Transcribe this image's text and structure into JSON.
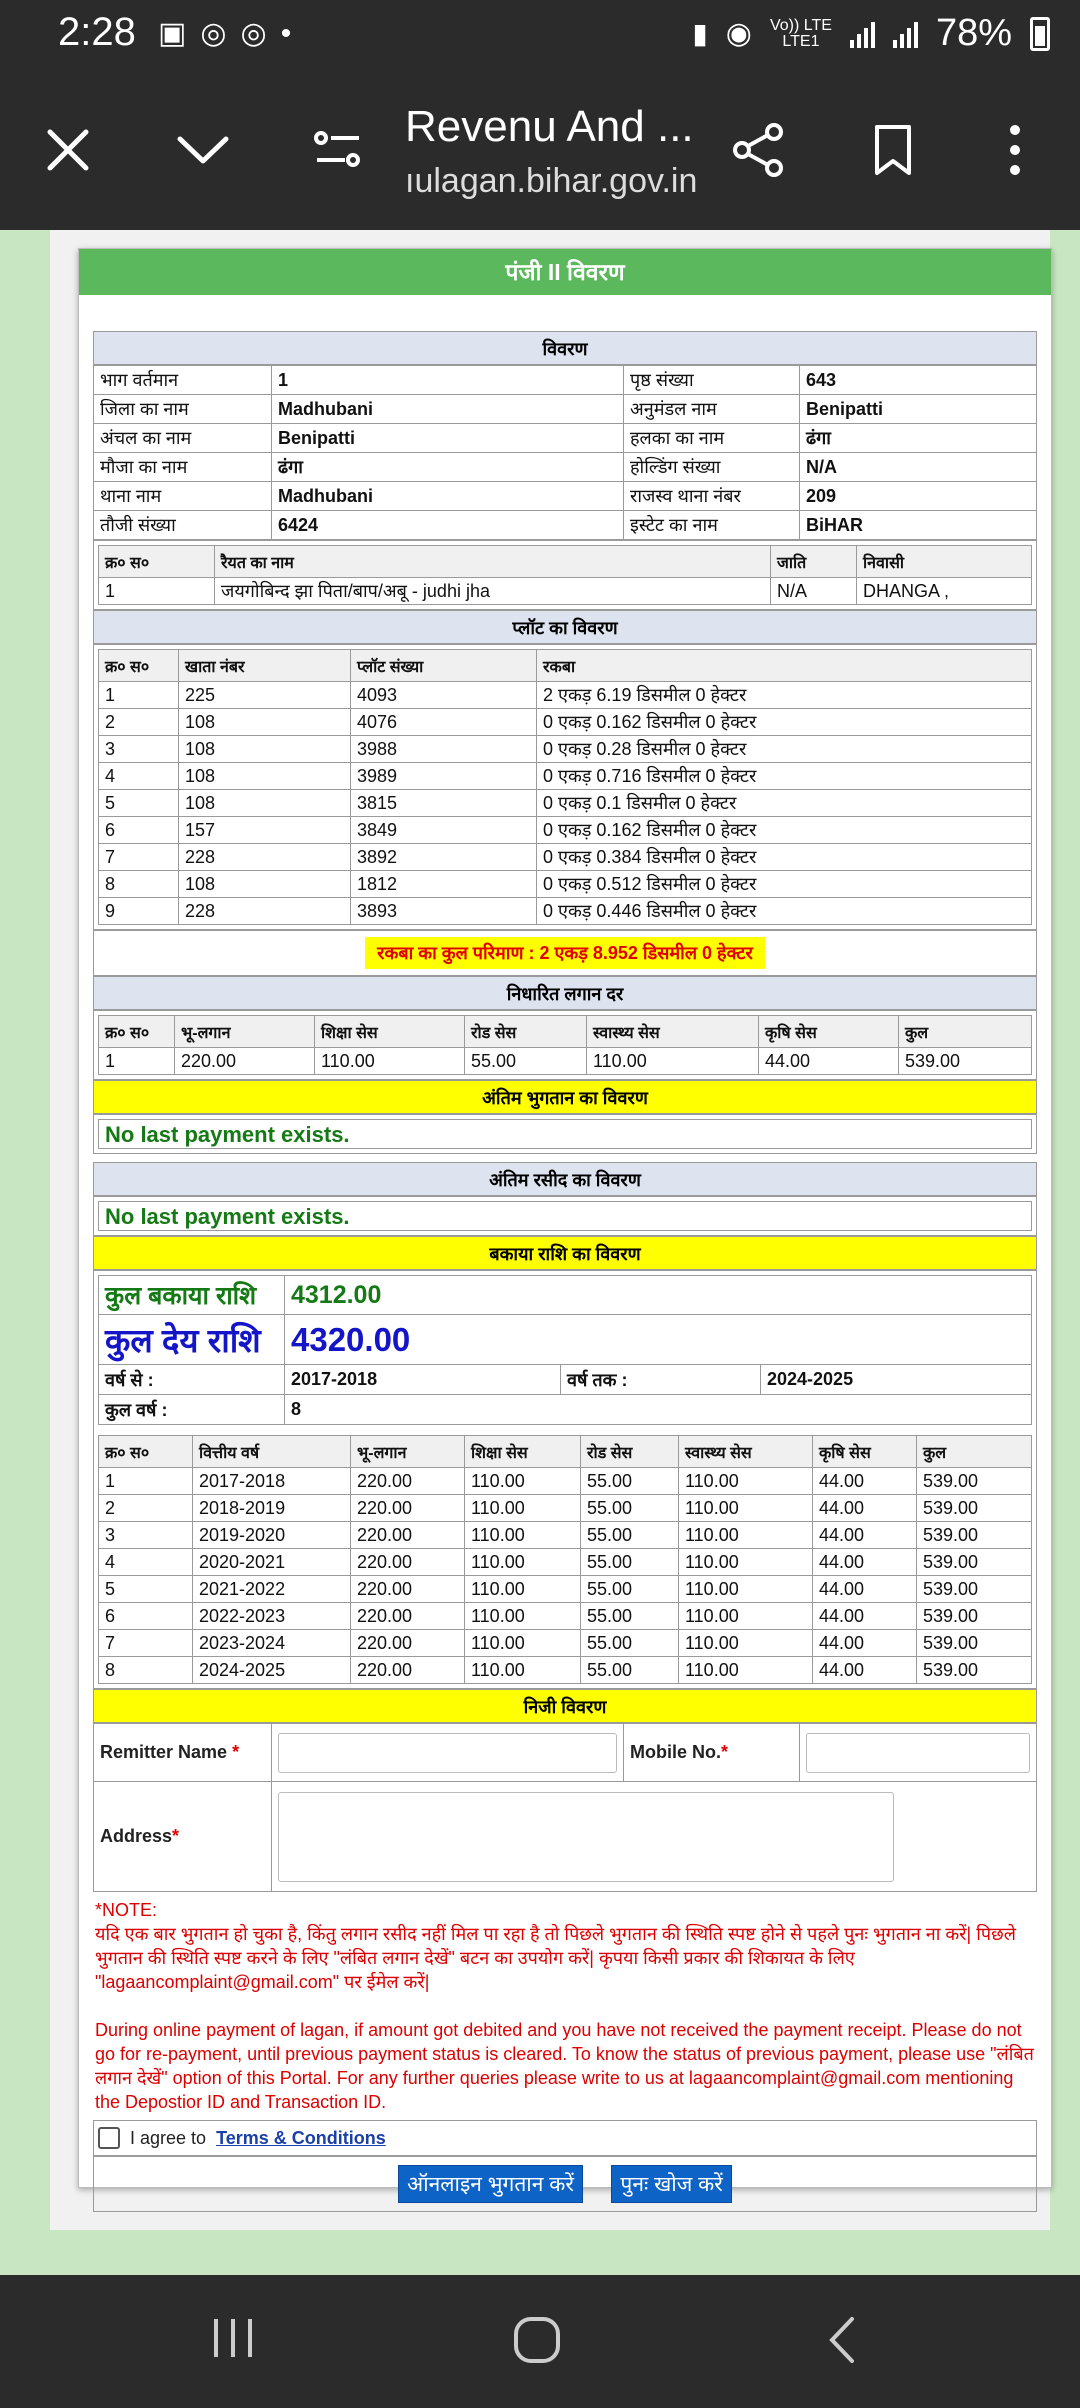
{
  "status": {
    "time": "2:28",
    "battery": "78%",
    "lte1": "Vo)) LTE",
    "lte2": "LTE1",
    "lte_label": "LTE"
  },
  "browser": {
    "title": "Revenu And ...",
    "url": "ıulagan.bihar.gov.in"
  },
  "panel": {
    "title": "पंजी II विवरण"
  },
  "vivaran": {
    "title": "विवरण",
    "rows": [
      [
        "भाग वर्तमान",
        "1",
        "पृष्ठ संख्या",
        "643"
      ],
      [
        "जिला का नाम",
        "Madhubani",
        "अनुमंडल नाम",
        "Benipatti"
      ],
      [
        "अंचल का नाम",
        "Benipatti",
        "हलका का नाम",
        "ढंगा"
      ],
      [
        "मौजा का नाम",
        "ढंगा",
        "होल्डिंग संख्या",
        "N/A"
      ],
      [
        "थाना नाम",
        "Madhubani",
        "राजस्व थाना नंबर",
        "209"
      ],
      [
        "तौजी संख्या",
        "6424",
        "इस्टेट का नाम",
        "BiHAR"
      ]
    ]
  },
  "raiyat": {
    "headers": [
      "क्र० स०",
      "रैयत का नाम",
      "जाति",
      "निवासी"
    ],
    "rows": [
      [
        "1",
        "जयगोबिन्द झा पिता/बाप/अबू - judhi jha",
        "N/A",
        "DHANGA ,"
      ]
    ]
  },
  "plot": {
    "title": "प्लॉट का विवरण",
    "headers": [
      "क्र० स०",
      "खाता नंबर",
      "प्लॉट संख्या",
      "रकबा"
    ],
    "rows": [
      [
        "1",
        "225",
        "4093",
        "2 एकड़ 6.19 डिसमील 0 हेक्टर"
      ],
      [
        "2",
        "108",
        "4076",
        "0 एकड़ 0.162 डिसमील 0 हेक्टर"
      ],
      [
        "3",
        "108",
        "3988",
        "0 एकड़ 0.28 डिसमील 0 हेक्टर"
      ],
      [
        "4",
        "108",
        "3989",
        "0 एकड़ 0.716 डिसमील 0 हेक्टर"
      ],
      [
        "5",
        "108",
        "3815",
        "0 एकड़ 0.1 डिसमील 0 हेक्टर"
      ],
      [
        "6",
        "157",
        "3849",
        "0 एकड़ 0.162 डिसमील 0 हेक्टर"
      ],
      [
        "7",
        "228",
        "3892",
        "0 एकड़ 0.384 डिसमील 0 हेक्टर"
      ],
      [
        "8",
        "108",
        "1812",
        "0 एकड़ 0.512 डिसमील 0 हेक्टर"
      ],
      [
        "9",
        "228",
        "3893",
        "0 एकड़ 0.446 डिसमील 0 हेक्टर"
      ]
    ],
    "total": "रकबा का कुल परिमाण : 2 एकड़ 8.952 डिसमील 0 हेक्टर"
  },
  "lagan": {
    "title": "निधारित लगान दर",
    "headers": [
      "क्र० स०",
      "भू-लगान",
      "शिक्षा सेस",
      "रोड सेस",
      "स्वास्थ्य सेस",
      "कृषि सेस",
      "कुल"
    ],
    "rows": [
      [
        "1",
        "220.00",
        "110.00",
        "55.00",
        "110.00",
        "44.00",
        "539.00"
      ]
    ]
  },
  "last_payment": {
    "title": "अंतिम भुगतान का विवरण",
    "text": "No last payment exists."
  },
  "last_receipt": {
    "title": "अंतिम रसीद का विवरण",
    "text": "No last payment exists."
  },
  "dues": {
    "title": "बकाया राशि का विवरण",
    "kul_bakaya_label": "कुल बकाया राशि",
    "kul_bakaya_value": "4312.00",
    "kul_dey_label": "कुल देय राशि",
    "kul_dey_value": "4320.00",
    "from_label": "वर्ष से :",
    "from_value": "2017-2018",
    "to_label": "वर्ष तक :",
    "to_value": "2024-2025",
    "years_label": "कुल वर्ष :",
    "years_value": "8",
    "headers": [
      "क्र० स०",
      "वित्तीय वर्ष",
      "भू-लगान",
      "शिक्षा सेस",
      "रोड सेस",
      "स्वास्थ्य सेस",
      "कृषि सेस",
      "कुल"
    ],
    "rows": [
      [
        "1",
        "2017-2018",
        "220.00",
        "110.00",
        "55.00",
        "110.00",
        "44.00",
        "539.00"
      ],
      [
        "2",
        "2018-2019",
        "220.00",
        "110.00",
        "55.00",
        "110.00",
        "44.00",
        "539.00"
      ],
      [
        "3",
        "2019-2020",
        "220.00",
        "110.00",
        "55.00",
        "110.00",
        "44.00",
        "539.00"
      ],
      [
        "4",
        "2020-2021",
        "220.00",
        "110.00",
        "55.00",
        "110.00",
        "44.00",
        "539.00"
      ],
      [
        "5",
        "2021-2022",
        "220.00",
        "110.00",
        "55.00",
        "110.00",
        "44.00",
        "539.00"
      ],
      [
        "6",
        "2022-2023",
        "220.00",
        "110.00",
        "55.00",
        "110.00",
        "44.00",
        "539.00"
      ],
      [
        "7",
        "2023-2024",
        "220.00",
        "110.00",
        "55.00",
        "110.00",
        "44.00",
        "539.00"
      ],
      [
        "8",
        "2024-2025",
        "220.00",
        "110.00",
        "55.00",
        "110.00",
        "44.00",
        "539.00"
      ]
    ]
  },
  "personal": {
    "title": "निजी विवरण",
    "remitter_label": "Remitter Name",
    "mobile_label": "Mobile No.",
    "address_label": "Address",
    "required_mark": "*"
  },
  "note": {
    "title": "*NOTE:",
    "hindi": "यदि एक बार भुगतान हो चुका है, किंतु लगान रसीद नहीं मिल पा रहा है तो पिछले भुगतान की स्थिति स्पष्ट होने से पहले पुनः भुगतान ना करें| पिछले भुगतान की स्थिति स्पष्ट करने के लिए \"लंबित लगान देखें\" बटन का उपयोग करें| कृपया किसी प्रकार की शिकायत के लिए \"lagaancomplaint@gmail.com\" पर ईमेल करें|",
    "english": "During online payment of lagan, if amount got debited and you have not received the payment receipt. Please do not go for re-payment, until previous payment status is cleared. To know the status of previous payment, please use \"लंबित लगान देखें\" option of this Portal. For any further queries please write to us at lagaancomplaint@gmail.com mentioning the Depostior ID and Transaction ID."
  },
  "agree": {
    "prefix": "I agree to",
    "link": "Terms & Conditions"
  },
  "buttons": {
    "pay": "ऑनलाइन भुगतान करें",
    "search": "पुनः खोज करें"
  }
}
